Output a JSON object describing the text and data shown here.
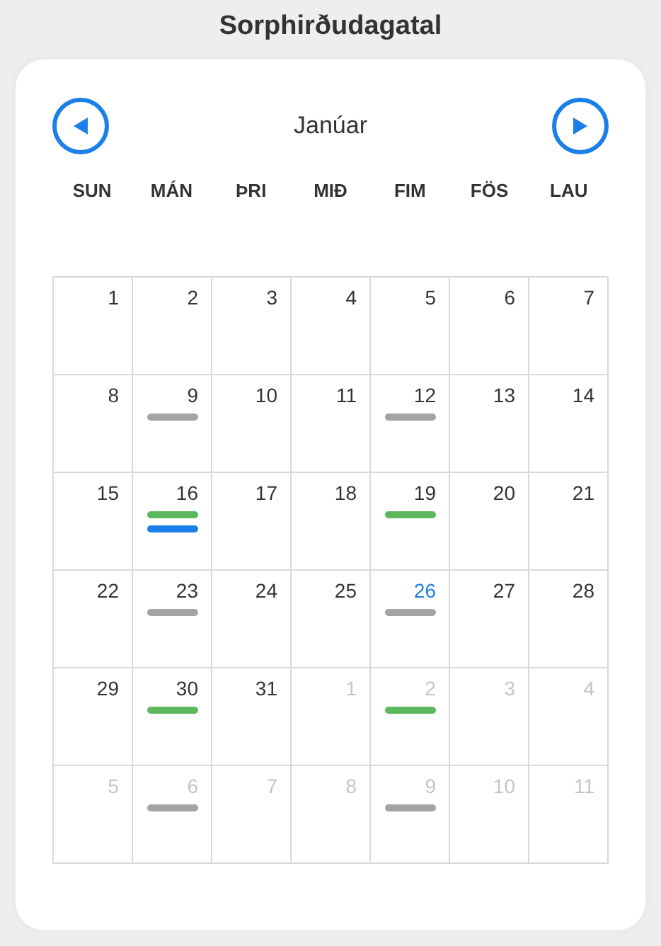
{
  "title": "Sorphirðudagatal",
  "month": "Janúar",
  "weekdays": [
    "SUN",
    "MÁN",
    "ÞRI",
    "MIÐ",
    "FIM",
    "FÖS",
    "LAU"
  ],
  "weeks": [
    [
      {
        "day": "1",
        "outside_month": false,
        "today": false
      },
      {
        "day": "2",
        "outside_month": false,
        "today": false
      },
      {
        "day": "3",
        "outside_month": false,
        "today": false
      },
      {
        "day": "4",
        "outside_month": false,
        "today": false
      },
      {
        "day": "5",
        "outside_month": false,
        "today": false
      },
      {
        "day": "6",
        "outside_month": false,
        "today": false
      },
      {
        "day": "7",
        "outside_month": false,
        "today": false
      }
    ],
    [
      {
        "day": "8",
        "outside_month": false,
        "today": false
      },
      {
        "day": "9",
        "outside_month": false,
        "today": false,
        "events": [
          {
            "color": "#a3a3a3"
          }
        ]
      },
      {
        "day": "10",
        "outside_month": false,
        "today": false
      },
      {
        "day": "11",
        "outside_month": false,
        "today": false
      },
      {
        "day": "12",
        "outside_month": false,
        "today": false,
        "events": [
          {
            "color": "#a3a3a3"
          }
        ]
      },
      {
        "day": "13",
        "outside_month": false,
        "today": false
      },
      {
        "day": "14",
        "outside_month": false,
        "today": false
      }
    ],
    [
      {
        "day": "15",
        "outside_month": false,
        "today": false
      },
      {
        "day": "16",
        "outside_month": false,
        "today": false,
        "events": [
          {
            "color": "#5cb85c"
          },
          {
            "color": "#1a7fe8"
          }
        ]
      },
      {
        "day": "17",
        "outside_month": false,
        "today": false
      },
      {
        "day": "18",
        "outside_month": false,
        "today": false
      },
      {
        "day": "19",
        "outside_month": false,
        "today": false,
        "events": [
          {
            "color": "#5cb85c"
          }
        ]
      },
      {
        "day": "20",
        "outside_month": false,
        "today": false
      },
      {
        "day": "21",
        "outside_month": false,
        "today": false
      }
    ],
    [
      {
        "day": "22",
        "outside_month": false,
        "today": false
      },
      {
        "day": "23",
        "outside_month": false,
        "today": false,
        "events": [
          {
            "color": "#a3a3a3"
          }
        ]
      },
      {
        "day": "24",
        "outside_month": false,
        "today": false
      },
      {
        "day": "25",
        "outside_month": false,
        "today": false
      },
      {
        "day": "26",
        "outside_month": false,
        "today": true,
        "events": [
          {
            "color": "#a3a3a3"
          }
        ]
      },
      {
        "day": "27",
        "outside_month": false,
        "today": false
      },
      {
        "day": "28",
        "outside_month": false,
        "today": false
      }
    ],
    [
      {
        "day": "29",
        "outside_month": false,
        "today": false
      },
      {
        "day": "30",
        "outside_month": false,
        "today": false,
        "events": [
          {
            "color": "#5cb85c"
          }
        ]
      },
      {
        "day": "31",
        "outside_month": false,
        "today": false
      },
      {
        "day": "1",
        "outside_month": true,
        "today": false
      },
      {
        "day": "2",
        "outside_month": true,
        "today": false,
        "events": [
          {
            "color": "#5cb85c"
          }
        ]
      },
      {
        "day": "3",
        "outside_month": true,
        "today": false
      },
      {
        "day": "4",
        "outside_month": true,
        "today": false
      }
    ],
    [
      {
        "day": "5",
        "outside_month": true,
        "today": false
      },
      {
        "day": "6",
        "outside_month": true,
        "today": false,
        "events": [
          {
            "color": "#a3a3a3"
          }
        ]
      },
      {
        "day": "7",
        "outside_month": true,
        "today": false
      },
      {
        "day": "8",
        "outside_month": true,
        "today": false
      },
      {
        "day": "9",
        "outside_month": true,
        "today": false,
        "events": [
          {
            "color": "#a3a3a3"
          }
        ]
      },
      {
        "day": "10",
        "outside_month": true,
        "today": false
      },
      {
        "day": "11",
        "outside_month": true,
        "today": false
      }
    ]
  ]
}
